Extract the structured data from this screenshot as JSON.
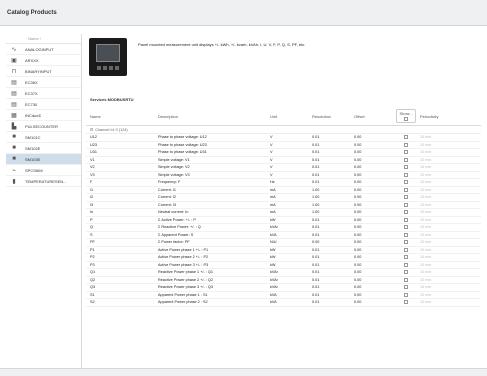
{
  "window": {
    "title": "Catalog Products"
  },
  "sidebar": {
    "header": "Name ↑",
    "items": [
      {
        "label": "ANALOGINPUT",
        "icon": "analog-input-icon"
      },
      {
        "label": "ARXXX",
        "icon": "arxxx-device-icon"
      },
      {
        "label": "BINARYINPUT",
        "icon": "binary-input-icon"
      },
      {
        "label": "EC36X",
        "icon": "meter-icon"
      },
      {
        "label": "EC37X",
        "icon": "meter-icon"
      },
      {
        "label": "EC730",
        "icon": "meter-icon"
      },
      {
        "label": "INCdueD",
        "icon": "inc-device-icon"
      },
      {
        "label": "PULSECOUNTER",
        "icon": "pulse-counter-icon"
      },
      {
        "label": "SM101C",
        "icon": "sm-device-icon"
      },
      {
        "label": "SM102E",
        "icon": "sm-device-icon"
      },
      {
        "label": "SM103E",
        "icon": "sm-device-icon",
        "selected": true
      },
      {
        "label": "SPCS6IM",
        "icon": "spcs-device-icon"
      },
      {
        "label": "TEMPERATURESEN...",
        "icon": "temperature-sensor-icon"
      }
    ]
  },
  "main": {
    "description": "Panel mounted measurement unit displays +/- kWh, +/- kvarh, kVAh, I, U, V, F, P, Q, S, PF, etc.",
    "services_label": "Services MODBUSRTU",
    "columns": {
      "name": "Name",
      "description": "Description",
      "unit": "Unit",
      "resolution": "Resolution",
      "offset": "Offset",
      "show": "Show...",
      "periodicity": "Periodicity"
    },
    "channel_label": "Channel Id: 0 (124)",
    "rows": [
      {
        "name": "U12",
        "description": "Phase to phase voltage: U12",
        "unit": "V",
        "resolution": "0.01",
        "offset": "0.00",
        "periodicity": "10 min"
      },
      {
        "name": "U23",
        "description": "Phase to phase voltage: U23",
        "unit": "V",
        "resolution": "0.01",
        "offset": "0.00",
        "periodicity": "10 min"
      },
      {
        "name": "U31",
        "description": "Phase to phase voltage: U31",
        "unit": "V",
        "resolution": "0.01",
        "offset": "0.00",
        "periodicity": "10 min"
      },
      {
        "name": "V1",
        "description": "Simple voltage: V1",
        "unit": "V",
        "resolution": "0.01",
        "offset": "0.00",
        "periodicity": "10 min"
      },
      {
        "name": "V2",
        "description": "Simple voltage: V2",
        "unit": "V",
        "resolution": "0.01",
        "offset": "0.00",
        "periodicity": "10 min"
      },
      {
        "name": "V3",
        "description": "Simple voltage: V3",
        "unit": "V",
        "resolution": "0.01",
        "offset": "0.00",
        "periodicity": "10 min"
      },
      {
        "name": "F",
        "description": "Frequency: F",
        "unit": "Hz",
        "resolution": "0.01",
        "offset": "0.00",
        "periodicity": "10 min"
      },
      {
        "name": "I1",
        "description": "Current: I1",
        "unit": "mA",
        "resolution": "1.00",
        "offset": "0.00",
        "periodicity": "10 min"
      },
      {
        "name": "I2",
        "description": "Current: I2",
        "unit": "mA",
        "resolution": "1.00",
        "offset": "0.00",
        "periodicity": "10 min"
      },
      {
        "name": "I3",
        "description": "Current: I3",
        "unit": "mA",
        "resolution": "1.00",
        "offset": "0.00",
        "periodicity": "10 min"
      },
      {
        "name": "In",
        "description": "Neutral current: In",
        "unit": "mA",
        "resolution": "1.00",
        "offset": "0.00",
        "periodicity": "10 min"
      },
      {
        "name": "P",
        "description": "Σ Active Power: +/- : P",
        "unit": "kW",
        "resolution": "0.01",
        "offset": "0.00",
        "periodicity": "10 min"
      },
      {
        "name": "Q",
        "description": "Σ Reactive Power: +/- : Q",
        "unit": "kVAr",
        "resolution": "0.01",
        "offset": "0.00",
        "periodicity": "10 min"
      },
      {
        "name": "S",
        "description": "Σ Apparent Power: S",
        "unit": "kVA",
        "resolution": "0.01",
        "offset": "0.00",
        "periodicity": "10 min"
      },
      {
        "name": "PF",
        "description": "Σ Power factor: PF",
        "unit": "N/U",
        "resolution": "0.00",
        "offset": "0.00",
        "periodicity": "10 min"
      },
      {
        "name": "P1",
        "description": "Active Power phase 1 +/- : P1",
        "unit": "kW",
        "resolution": "0.01",
        "offset": "0.00",
        "periodicity": "10 min"
      },
      {
        "name": "P2",
        "description": "Active Power phase 2 +/- : P2",
        "unit": "kW",
        "resolution": "0.01",
        "offset": "0.00",
        "periodicity": "10 min"
      },
      {
        "name": "P3",
        "description": "Active Power phase 3 +/- : P3",
        "unit": "kW",
        "resolution": "0.01",
        "offset": "0.00",
        "periodicity": "10 min"
      },
      {
        "name": "Q1",
        "description": "Reactive Power phase 1 +/- : Q1",
        "unit": "kVAr",
        "resolution": "0.01",
        "offset": "0.00",
        "periodicity": "10 min"
      },
      {
        "name": "Q2",
        "description": "Reactive Power phase 2 +/- : Q2",
        "unit": "kVAr",
        "resolution": "0.01",
        "offset": "0.00",
        "periodicity": "10 min"
      },
      {
        "name": "Q3",
        "description": "Reactive Power phase 3 +/- : Q3",
        "unit": "kVAr",
        "resolution": "0.01",
        "offset": "0.00",
        "periodicity": "10 min"
      },
      {
        "name": "S1",
        "description": "Apparent Power phase 1 : S1",
        "unit": "kVA",
        "resolution": "0.01",
        "offset": "0.00",
        "periodicity": "10 min"
      },
      {
        "name": "S2",
        "description": "Apparent Power phase 2 : S2",
        "unit": "kVA",
        "resolution": "0.01",
        "offset": "0.00",
        "periodicity": "10 min"
      }
    ]
  },
  "colors": {
    "selected_row": "#cfdcea",
    "title_bar": "#eef0f2",
    "device_body": "#1b1b1b"
  }
}
